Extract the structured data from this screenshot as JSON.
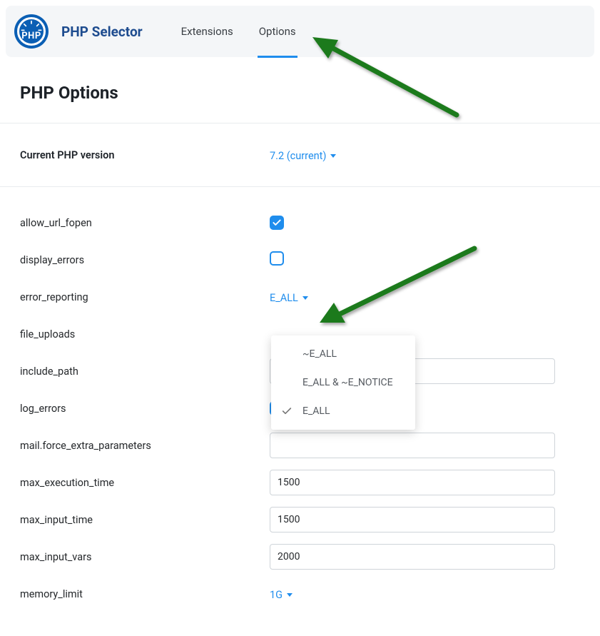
{
  "header": {
    "app_title": "PHP Selector",
    "logo_text": "PHP",
    "tabs": [
      {
        "label": "Extensions"
      },
      {
        "label": "Options"
      }
    ]
  },
  "page_title": "PHP Options",
  "version_row": {
    "label": "Current PHP version",
    "value": "7.2 (current)"
  },
  "options": [
    {
      "key": "allow_url_fopen",
      "type": "checkbox",
      "checked": true
    },
    {
      "key": "display_errors",
      "type": "checkbox",
      "checked": false
    },
    {
      "key": "error_reporting",
      "type": "select",
      "value": "E_ALL",
      "open": true,
      "items": [
        "~E_ALL",
        "E_ALL & ~E_NOTICE",
        "E_ALL"
      ],
      "selected": "E_ALL"
    },
    {
      "key": "file_uploads",
      "type": "checkbox_hidden"
    },
    {
      "key": "include_path",
      "type": "text",
      "value": ""
    },
    {
      "key": "log_errors",
      "type": "checkbox",
      "checked": true
    },
    {
      "key": "mail.force_extra_parameters",
      "type": "text",
      "value": ""
    },
    {
      "key": "max_execution_time",
      "type": "text",
      "value": "1500"
    },
    {
      "key": "max_input_time",
      "type": "text",
      "value": "1500"
    },
    {
      "key": "max_input_vars",
      "type": "text",
      "value": "2000"
    },
    {
      "key": "memory_limit",
      "type": "select",
      "value": "1G"
    }
  ],
  "colors": {
    "accent": "#1f8ded",
    "arrow": "#1b7a1b"
  }
}
